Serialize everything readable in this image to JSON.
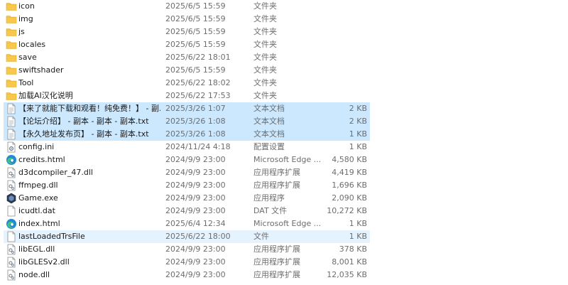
{
  "files": [
    {
      "name": "icon",
      "date": "2025/6/5 15:59",
      "type": "文件夹",
      "size": "",
      "icon": "folder-icon",
      "state": ""
    },
    {
      "name": "img",
      "date": "2025/6/5 15:59",
      "type": "文件夹",
      "size": "",
      "icon": "folder-icon",
      "state": ""
    },
    {
      "name": "js",
      "date": "2025/6/5 15:59",
      "type": "文件夹",
      "size": "",
      "icon": "folder-icon",
      "state": ""
    },
    {
      "name": "locales",
      "date": "2025/6/5 15:59",
      "type": "文件夹",
      "size": "",
      "icon": "folder-icon",
      "state": ""
    },
    {
      "name": "save",
      "date": "2025/6/22 18:01",
      "type": "文件夹",
      "size": "",
      "icon": "folder-icon",
      "state": ""
    },
    {
      "name": "swiftshader",
      "date": "2025/6/5 15:59",
      "type": "文件夹",
      "size": "",
      "icon": "folder-icon",
      "state": ""
    },
    {
      "name": "Tool",
      "date": "2025/6/22 18:02",
      "type": "文件夹",
      "size": "",
      "icon": "folder-icon",
      "state": ""
    },
    {
      "name": "加载AI汉化说明",
      "date": "2025/6/22 17:53",
      "type": "文件夹",
      "size": "",
      "icon": "folder-icon",
      "state": ""
    },
    {
      "name": "【来了就能下载和观看！纯免费！】 - 副...",
      "date": "2025/3/26 1:07",
      "type": "文本文档",
      "size": "2 KB",
      "icon": "text-file-icon",
      "state": "selected"
    },
    {
      "name": "【论坛介绍】 - 副本 - 副本 - 副本.txt",
      "date": "2025/3/26 1:08",
      "type": "文本文档",
      "size": "2 KB",
      "icon": "text-file-icon",
      "state": "selected"
    },
    {
      "name": "【永久地址发布页】 - 副本 - 副本.txt",
      "date": "2025/3/26 1:08",
      "type": "文本文档",
      "size": "1 KB",
      "icon": "text-file-icon",
      "state": "selected"
    },
    {
      "name": "config.ini",
      "date": "2024/11/24 4:18",
      "type": "配置设置",
      "size": "1 KB",
      "icon": "settings-file-icon",
      "state": ""
    },
    {
      "name": "credits.html",
      "date": "2024/9/9 23:00",
      "type": "Microsoft Edge ...",
      "size": "4,580 KB",
      "icon": "edge-icon",
      "state": ""
    },
    {
      "name": "d3dcompiler_47.dll",
      "date": "2024/9/9 23:00",
      "type": "应用程序扩展",
      "size": "4,419 KB",
      "icon": "dll-file-icon",
      "state": ""
    },
    {
      "name": "ffmpeg.dll",
      "date": "2024/9/9 23:00",
      "type": "应用程序扩展",
      "size": "1,696 KB",
      "icon": "dll-file-icon",
      "state": ""
    },
    {
      "name": "Game.exe",
      "date": "2024/9/9 23:00",
      "type": "应用程序",
      "size": "2,090 KB",
      "icon": "game-exe-icon",
      "state": ""
    },
    {
      "name": "icudtl.dat",
      "date": "2024/9/9 23:00",
      "type": "DAT 文件",
      "size": "10,272 KB",
      "icon": "blank-file-icon",
      "state": ""
    },
    {
      "name": "index.html",
      "date": "2025/6/4 12:34",
      "type": "Microsoft Edge ...",
      "size": "1 KB",
      "icon": "edge-icon",
      "state": ""
    },
    {
      "name": "lastLoadedTrsFile",
      "date": "2025/6/22 18:00",
      "type": "文件",
      "size": "1 KB",
      "icon": "blank-file-icon",
      "state": "hover"
    },
    {
      "name": "libEGL.dll",
      "date": "2024/9/9 23:00",
      "type": "应用程序扩展",
      "size": "378 KB",
      "icon": "dll-file-icon",
      "state": ""
    },
    {
      "name": "libGLESv2.dll",
      "date": "2024/9/9 23:00",
      "type": "应用程序扩展",
      "size": "8,001 KB",
      "icon": "dll-file-icon",
      "state": ""
    },
    {
      "name": "node.dll",
      "date": "2024/9/9 23:00",
      "type": "应用程序扩展",
      "size": "12,035 KB",
      "icon": "dll-file-icon",
      "state": ""
    }
  ],
  "colors": {
    "folder": "#f8c84a",
    "selected_bg": "#cce8ff",
    "hover_bg": "#e5f3ff",
    "edge_blue": "#1f8ad8",
    "edge_green": "#48c37a",
    "meta_text": "#6d6d6d"
  }
}
